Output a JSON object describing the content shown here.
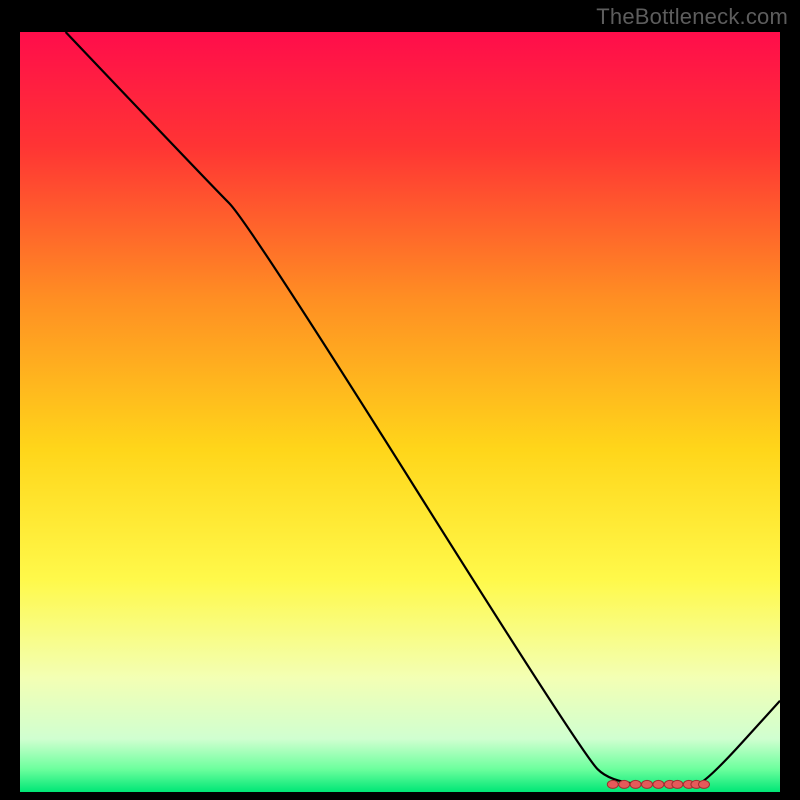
{
  "watermark": "TheBottleneck.com",
  "colors": {
    "background": "#000000",
    "gradient_stops": [
      {
        "offset": 0.0,
        "color": "#ff0d4b"
      },
      {
        "offset": 0.15,
        "color": "#ff3434"
      },
      {
        "offset": 0.35,
        "color": "#ff8e23"
      },
      {
        "offset": 0.55,
        "color": "#ffd61a"
      },
      {
        "offset": 0.72,
        "color": "#fff94a"
      },
      {
        "offset": 0.85,
        "color": "#f3ffb4"
      },
      {
        "offset": 0.93,
        "color": "#d0ffd0"
      },
      {
        "offset": 0.97,
        "color": "#6cff9d"
      },
      {
        "offset": 1.0,
        "color": "#00e676"
      }
    ],
    "line": "#000000",
    "marker_fill": "#e55a5a",
    "marker_stroke": "#a02f2f"
  },
  "chart_data": {
    "type": "line",
    "title": "",
    "xlabel": "",
    "ylabel": "",
    "xlim": [
      0,
      100
    ],
    "ylim": [
      0,
      100
    ],
    "series": [
      {
        "name": "curve",
        "x": [
          6,
          25,
          30,
          74,
          78,
          88,
          90,
          100
        ],
        "y": [
          100,
          80,
          75,
          5,
          1,
          1,
          1,
          12
        ]
      }
    ],
    "markers": {
      "name": "optimal-range",
      "x": [
        78,
        79.5,
        81,
        82.5,
        84,
        85.5,
        86.5,
        88,
        89,
        90
      ],
      "y": [
        1,
        1,
        1,
        1,
        1,
        1,
        1,
        1,
        1,
        1
      ]
    }
  }
}
